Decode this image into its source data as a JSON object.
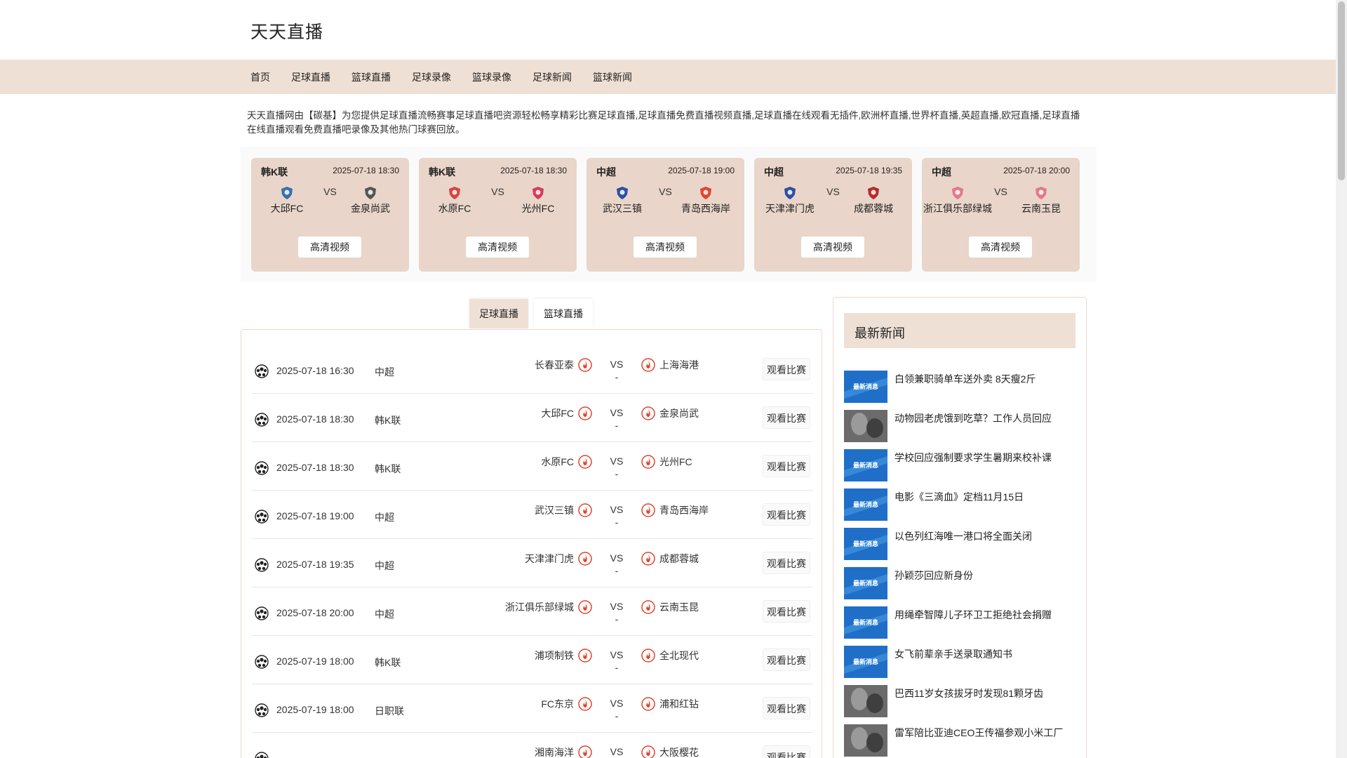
{
  "site": {
    "title": "天天直播"
  },
  "nav": {
    "items": [
      "首页",
      "足球直播",
      "篮球直播",
      "足球录像",
      "篮球录像",
      "足球新闻",
      "篮球新闻"
    ]
  },
  "intro": "天天直播网由【碳基】为您提供足球直播流畅赛事足球直播吧资源轻松畅享精彩比赛足球直播,足球直播免费直播视频直播,足球直播在线观看无插件,欧洲杯直播,世界杯直播,英超直播,欧冠直播,足球直播在线直播观看免费直播吧录像及其他热门球赛回放。",
  "featured": {
    "vs_label": "VS",
    "button_label": "高清视频",
    "matches": [
      {
        "league": "韩K联",
        "time": "2025-07-18 18:30",
        "home": "大邱FC",
        "away": "金泉尚武",
        "home_color": "#3a6fb0",
        "away_color": "#555555"
      },
      {
        "league": "韩K联",
        "time": "2025-07-18 18:30",
        "home": "水原FC",
        "away": "光州FC",
        "home_color": "#d9443c",
        "away_color": "#d93a5a"
      },
      {
        "league": "中超",
        "time": "2025-07-18 19:00",
        "home": "武汉三镇",
        "away": "青岛西海岸",
        "home_color": "#2c4fa3",
        "away_color": "#e0452e"
      },
      {
        "league": "中超",
        "time": "2025-07-18 19:35",
        "home": "天津津门虎",
        "away": "成都蓉城",
        "home_color": "#2c4fa3",
        "away_color": "#b52b2b"
      },
      {
        "league": "中超",
        "time": "2025-07-18 20:00",
        "home": "浙江俱乐部绿城",
        "away": "云南玉昆",
        "home_color": "#e07a8a",
        "away_color": "#e07a8a"
      }
    ]
  },
  "tabs": {
    "football": "足球直播",
    "basketball": "篮球直播"
  },
  "match_list": {
    "vs_label": "VS",
    "score_placeholder": "-",
    "button_label": "观看比赛",
    "rows": [
      {
        "time": "2025-07-18 16:30",
        "league": "中超",
        "home": "长春亚泰",
        "away": "上海海港"
      },
      {
        "time": "2025-07-18 18:30",
        "league": "韩K联",
        "home": "大邱FC",
        "away": "金泉尚武"
      },
      {
        "time": "2025-07-18 18:30",
        "league": "韩K联",
        "home": "水原FC",
        "away": "光州FC"
      },
      {
        "time": "2025-07-18 19:00",
        "league": "中超",
        "home": "武汉三镇",
        "away": "青岛西海岸"
      },
      {
        "time": "2025-07-18 19:35",
        "league": "中超",
        "home": "天津津门虎",
        "away": "成都蓉城"
      },
      {
        "time": "2025-07-18 20:00",
        "league": "中超",
        "home": "浙江俱乐部绿城",
        "away": "云南玉昆"
      },
      {
        "time": "2025-07-19 18:00",
        "league": "韩K联",
        "home": "浦项制铁",
        "away": "全北现代"
      },
      {
        "time": "2025-07-19 18:00",
        "league": "日职联",
        "home": "FC东京",
        "away": "浦和红钻"
      },
      {
        "time": "",
        "league": "",
        "home": "湘南海洋",
        "away": "大阪樱花"
      }
    ]
  },
  "news": {
    "header": "最新新闻",
    "thumb_label": "最新消息",
    "items": [
      {
        "title": "白领兼职骑单车送外卖 8天瘦2斤",
        "thumb": "badge"
      },
      {
        "title": "动物园老虎饿到吃草？工作人员回应",
        "thumb": "photo"
      },
      {
        "title": "学校回应强制要求学生暑期来校补课",
        "thumb": "badge"
      },
      {
        "title": "电影《三滴血》定档11月15日",
        "thumb": "badge"
      },
      {
        "title": "以色列红海唯一港口将全面关闭",
        "thumb": "badge"
      },
      {
        "title": "孙颖莎回应新身份",
        "thumb": "badge"
      },
      {
        "title": "用绳牵智障儿子环卫工拒绝社会捐赠",
        "thumb": "badge"
      },
      {
        "title": "女飞前辈亲手送录取通知书",
        "thumb": "badge"
      },
      {
        "title": "巴西11岁女孩拔牙时发现81颗牙齿",
        "thumb": "photo"
      },
      {
        "title": "雷军陪比亚迪CEO王传福参观小米工厂",
        "thumb": "photo"
      }
    ]
  },
  "colors": {
    "accent": "#efe0d5",
    "card": "#e9d5c9",
    "badge_red": "#e0452e",
    "news_badge": "#1f6fc9"
  }
}
